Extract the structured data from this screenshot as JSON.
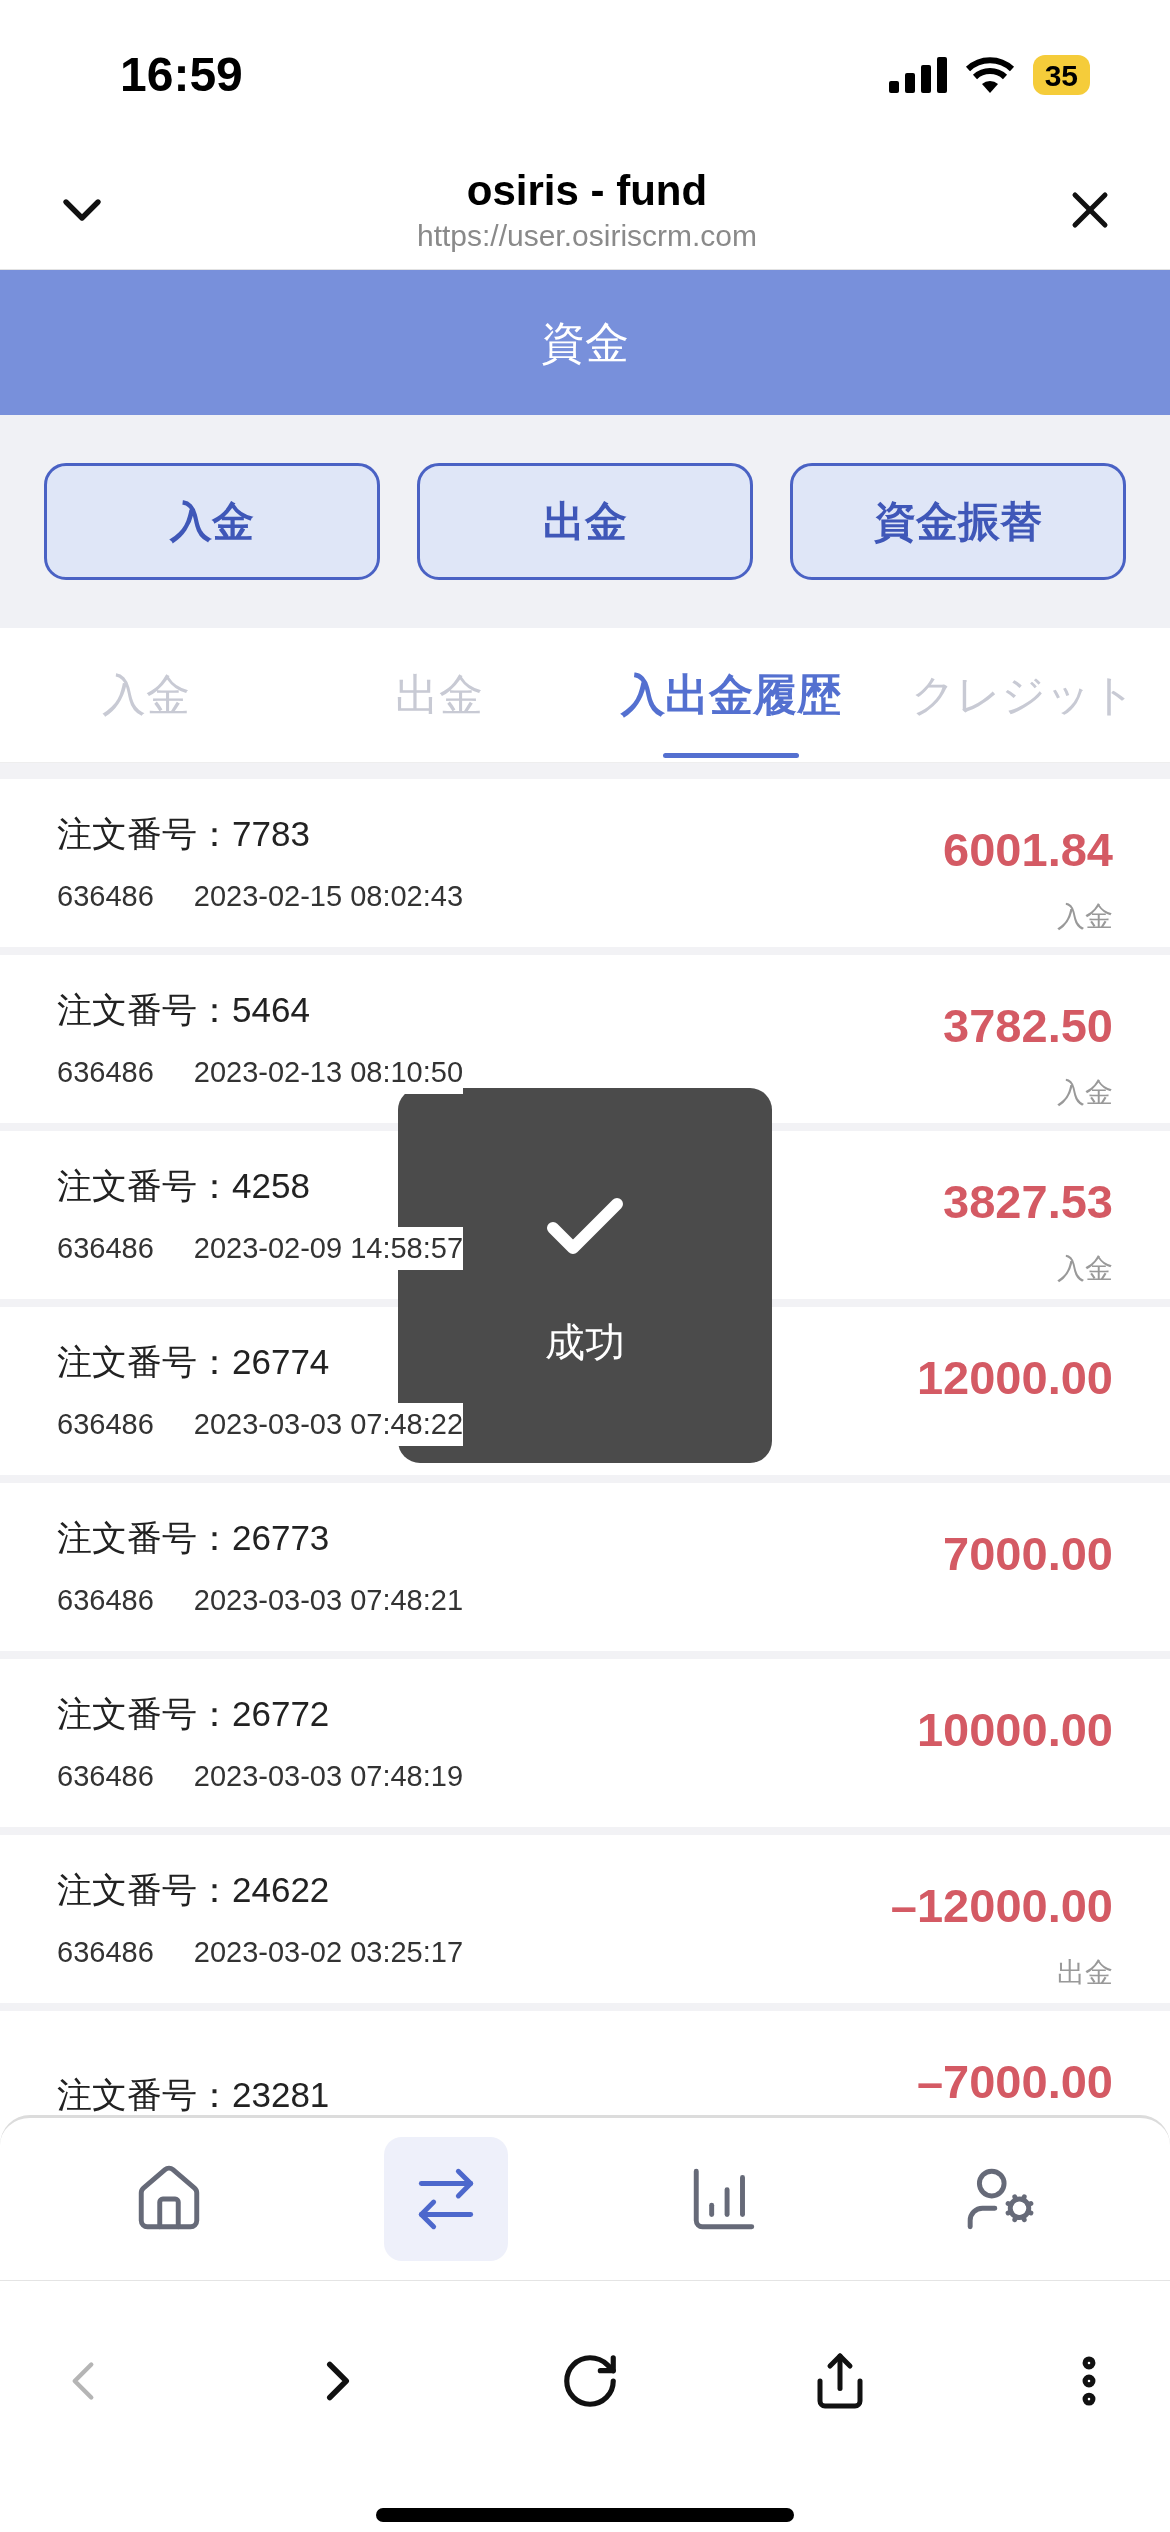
{
  "status_bar": {
    "time": "16:59",
    "battery": "35"
  },
  "browser": {
    "title": "osiris - fund",
    "url": "https://user.osiriscrm.com"
  },
  "page_title": "資金",
  "actions": [
    "入金",
    "出金",
    "資金振替"
  ],
  "tabs": [
    {
      "label": "入金",
      "selected": false
    },
    {
      "label": "出金",
      "selected": false
    },
    {
      "label": "入出金履歴",
      "selected": true
    },
    {
      "label": "クレジット",
      "selected": false
    }
  ],
  "records": [
    {
      "order": "注文番号：7783",
      "account": "636486",
      "time": "2023-02-15 08:02:43",
      "amount": "6001.84",
      "type": "入金"
    },
    {
      "order": "注文番号：5464",
      "account": "636486",
      "time": "2023-02-13 08:10:50",
      "amount": "3782.50",
      "type": "入金"
    },
    {
      "order": "注文番号：4258",
      "account": "636486",
      "time": "2023-02-09 14:58:57",
      "amount": "3827.53",
      "type": "入金"
    },
    {
      "order": "注文番号：26774",
      "account": "636486",
      "time": "2023-03-03 07:48:22",
      "amount": "12000.00"
    },
    {
      "order": "注文番号：26773",
      "account": "636486",
      "time": "2023-03-03 07:48:21",
      "amount": "7000.00"
    },
    {
      "order": "注文番号：26772",
      "account": "636486",
      "time": "2023-03-03 07:48:19",
      "amount": "10000.00"
    },
    {
      "order": "注文番号：24622",
      "account": "636486",
      "time": "2023-03-02 03:25:17",
      "amount": "–12000.00",
      "type": "出金"
    },
    {
      "order": "注文番号：23281",
      "amount": "–7000.00"
    }
  ],
  "toast": {
    "message": "成功"
  },
  "bottom_nav": [
    {
      "kind": "home",
      "selected": false
    },
    {
      "kind": "transfer",
      "selected": true
    },
    {
      "kind": "chart",
      "selected": false
    },
    {
      "kind": "profile",
      "selected": false
    }
  ],
  "browser_toolbar": {
    "back_disabled": true,
    "forward_disabled": false
  }
}
